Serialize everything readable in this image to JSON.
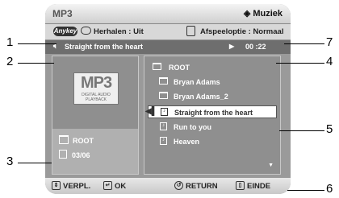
{
  "header": {
    "title": "MP3",
    "brand_label": "Muziek",
    "brand_icon": "diamond-icon"
  },
  "options": {
    "anykey_label": "Anykey",
    "repeat_label": "Herhalen : Uit",
    "playback_label": "Afspeeloptie : Normaal"
  },
  "now_playing": {
    "title": "Straight from the heart",
    "time": "00 :22"
  },
  "left_panel": {
    "logo_text": "MP3",
    "logo_subtext": "DIGITAL AUDIO PLAYBACK",
    "folder_label": "ROOT",
    "track_count": "03/06"
  },
  "file_list": [
    {
      "label": "ROOT",
      "type": "folder"
    },
    {
      "label": "Bryan Adams",
      "type": "folder"
    },
    {
      "label": "Bryan Adams_2",
      "type": "folder"
    },
    {
      "label": "Straight from the heart",
      "type": "track",
      "selected": true
    },
    {
      "label": "Run to you",
      "type": "track"
    },
    {
      "label": "Heaven",
      "type": "track"
    }
  ],
  "footer": {
    "move_label": "VERPL.",
    "ok_label": "OK",
    "return_label": "RETURN",
    "exit_label": "EINDE"
  },
  "callouts": [
    "1",
    "2",
    "3",
    "4",
    "5",
    "6",
    "7"
  ]
}
